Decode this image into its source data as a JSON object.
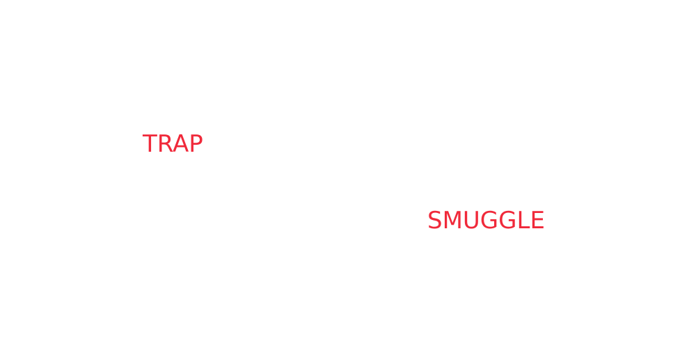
{
  "words": [
    {
      "text": "TRAP"
    },
    {
      "text": "SMUGGLE"
    }
  ],
  "colors": {
    "text": "#f0293a",
    "background": "#ffffff"
  }
}
